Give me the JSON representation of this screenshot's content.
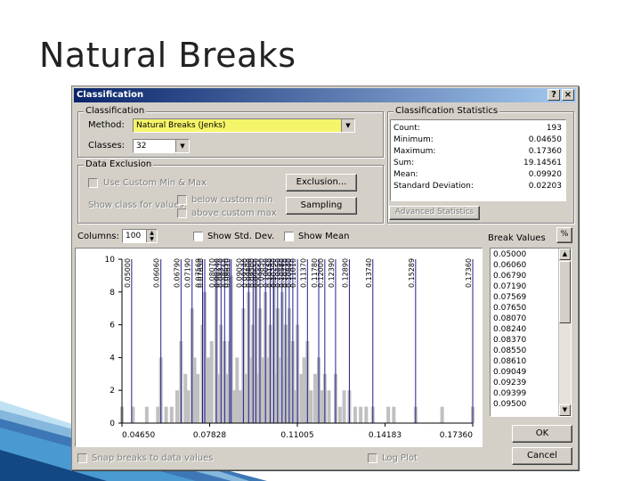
{
  "slide": {
    "title": "Natural Breaks"
  },
  "dialog": {
    "title": "Classification",
    "help_label": "?",
    "close_label": "×",
    "classification": {
      "group_title": "Classification",
      "method_label": "Method:",
      "method_value": "Natural Breaks (Jenks)",
      "classes_label": "Classes:",
      "classes_value": "32"
    },
    "exclusion": {
      "group_title": "Data Exclusion",
      "use_custom_label": "Use Custom Min & Max",
      "exclusion_button": "Exclusion...",
      "show_class_label": "Show class for values:",
      "below_label": "below custom min",
      "above_label": "above custom max",
      "sampling_button": "Sampling"
    },
    "statistics": {
      "group_title": "Classification Statistics",
      "rows": [
        {
          "label": "Count:",
          "value": "193"
        },
        {
          "label": "Minimum:",
          "value": "0.04650"
        },
        {
          "label": "Maximum:",
          "value": "0.17360"
        },
        {
          "label": "Sum:",
          "value": "19.14561"
        },
        {
          "label": "Mean:",
          "value": "0.09920"
        },
        {
          "label": "Standard Deviation:",
          "value": "0.02203"
        }
      ],
      "advanced_button": "Advanced Statistics"
    },
    "options": {
      "columns_label": "Columns:",
      "columns_value": "100",
      "show_std_dev_label": "Show Std. Dev.",
      "show_mean_label": "Show Mean",
      "break_values_label": "Break Values",
      "percent_button": "%"
    },
    "break_values": [
      "0.05000",
      "0.06060",
      "0.06790",
      "0.07190",
      "0.07569",
      "0.07650",
      "0.08070",
      "0.08240",
      "0.08370",
      "0.08550",
      "0.08610",
      "0.09049",
      "0.09239",
      "0.09399",
      "0.09500"
    ],
    "bottom": {
      "snap_label": "Snap breaks to data values",
      "log_plot_label": "Log Plot",
      "ok_button": "OK",
      "cancel_button": "Cancel"
    }
  },
  "chart_data": {
    "type": "bar",
    "x_ticks": [
      "0.04650",
      "0.07828",
      "0.11005",
      "0.14183",
      "0.17360"
    ],
    "x_tick_values": [
      0.0465,
      0.07828,
      0.11005,
      0.14183,
      0.1736
    ],
    "y_ticks": [
      "0",
      "2",
      "4",
      "6",
      "8",
      "10"
    ],
    "y_tick_values": [
      0,
      2,
      4,
      6,
      8,
      10
    ],
    "xlim": [
      0.0465,
      0.1736
    ],
    "ylim": [
      0,
      10
    ],
    "break_lines": [
      0.05,
      0.0606,
      0.0679,
      0.0719,
      0.07569,
      0.0765,
      0.0807,
      0.0824,
      0.0837,
      0.0855,
      0.0861,
      0.0905,
      0.0924,
      0.094,
      0.095,
      0.0965,
      0.0985,
      0.1002,
      0.1015,
      0.1029,
      0.1045,
      0.1058,
      0.1071,
      0.1084,
      0.1101,
      0.1137,
      0.1178,
      0.12,
      0.1239,
      0.1289,
      0.1374,
      0.1529,
      0.1736
    ],
    "break_labels": [
      "0.05000",
      "0.06060",
      "0.06790",
      "0.07190",
      "0.07569",
      "0.07650",
      "0.08070",
      "0.08240",
      "0.08370",
      "0.08550",
      "0.08610",
      "0.09050",
      "0.09240",
      "0.09400",
      "0.09500",
      "0.09650",
      "0.09850",
      "0.10020",
      "0.10150",
      "0.10290",
      "0.10450",
      "0.10580",
      "0.10710",
      "0.10840",
      "0.11010",
      "0.11370",
      "0.11780",
      "0.12000",
      "0.12390",
      "0.12890",
      "0.13740",
      "0.15289",
      "0.17360"
    ],
    "bars": [
      {
        "x": 0.0465,
        "y": 1
      },
      {
        "x": 0.0505,
        "y": 1
      },
      {
        "x": 0.0555,
        "y": 1
      },
      {
        "x": 0.0595,
        "y": 1
      },
      {
        "x": 0.0606,
        "y": 4
      },
      {
        "x": 0.0625,
        "y": 1
      },
      {
        "x": 0.0645,
        "y": 1
      },
      {
        "x": 0.0665,
        "y": 2
      },
      {
        "x": 0.0679,
        "y": 5
      },
      {
        "x": 0.0695,
        "y": 3
      },
      {
        "x": 0.0705,
        "y": 2
      },
      {
        "x": 0.0719,
        "y": 7
      },
      {
        "x": 0.0728,
        "y": 4
      },
      {
        "x": 0.074,
        "y": 3
      },
      {
        "x": 0.0757,
        "y": 6
      },
      {
        "x": 0.0765,
        "y": 8
      },
      {
        "x": 0.0778,
        "y": 4
      },
      {
        "x": 0.079,
        "y": 5
      },
      {
        "x": 0.0807,
        "y": 9
      },
      {
        "x": 0.0815,
        "y": 3
      },
      {
        "x": 0.0824,
        "y": 6
      },
      {
        "x": 0.0837,
        "y": 5
      },
      {
        "x": 0.0845,
        "y": 3
      },
      {
        "x": 0.0855,
        "y": 5
      },
      {
        "x": 0.0861,
        "y": 9
      },
      {
        "x": 0.0872,
        "y": 2
      },
      {
        "x": 0.0882,
        "y": 4
      },
      {
        "x": 0.0893,
        "y": 2
      },
      {
        "x": 0.0905,
        "y": 7
      },
      {
        "x": 0.0915,
        "y": 3
      },
      {
        "x": 0.0924,
        "y": 8
      },
      {
        "x": 0.0932,
        "y": 4
      },
      {
        "x": 0.094,
        "y": 6
      },
      {
        "x": 0.095,
        "y": 9
      },
      {
        "x": 0.0958,
        "y": 3
      },
      {
        "x": 0.0965,
        "y": 7
      },
      {
        "x": 0.0975,
        "y": 4
      },
      {
        "x": 0.0985,
        "y": 8
      },
      {
        "x": 0.0995,
        "y": 4
      },
      {
        "x": 0.1002,
        "y": 6
      },
      {
        "x": 0.1015,
        "y": 9
      },
      {
        "x": 0.1022,
        "y": 3
      },
      {
        "x": 0.1029,
        "y": 7
      },
      {
        "x": 0.1037,
        "y": 4
      },
      {
        "x": 0.1045,
        "y": 8
      },
      {
        "x": 0.1052,
        "y": 3
      },
      {
        "x": 0.1058,
        "y": 6
      },
      {
        "x": 0.1065,
        "y": 4
      },
      {
        "x": 0.1071,
        "y": 7
      },
      {
        "x": 0.1078,
        "y": 3
      },
      {
        "x": 0.1084,
        "y": 5
      },
      {
        "x": 0.1092,
        "y": 2
      },
      {
        "x": 0.1101,
        "y": 6
      },
      {
        "x": 0.1115,
        "y": 3
      },
      {
        "x": 0.1125,
        "y": 4
      },
      {
        "x": 0.1137,
        "y": 5
      },
      {
        "x": 0.115,
        "y": 2
      },
      {
        "x": 0.1165,
        "y": 3
      },
      {
        "x": 0.1178,
        "y": 4
      },
      {
        "x": 0.119,
        "y": 2
      },
      {
        "x": 0.12,
        "y": 3
      },
      {
        "x": 0.1215,
        "y": 2
      },
      {
        "x": 0.1239,
        "y": 3
      },
      {
        "x": 0.1255,
        "y": 1
      },
      {
        "x": 0.127,
        "y": 2
      },
      {
        "x": 0.1289,
        "y": 2
      },
      {
        "x": 0.131,
        "y": 1
      },
      {
        "x": 0.133,
        "y": 1
      },
      {
        "x": 0.135,
        "y": 1
      },
      {
        "x": 0.1374,
        "y": 1
      },
      {
        "x": 0.143,
        "y": 1
      },
      {
        "x": 0.145,
        "y": 1
      },
      {
        "x": 0.1529,
        "y": 1
      },
      {
        "x": 0.1625,
        "y": 1
      },
      {
        "x": 0.1736,
        "y": 1
      }
    ]
  }
}
